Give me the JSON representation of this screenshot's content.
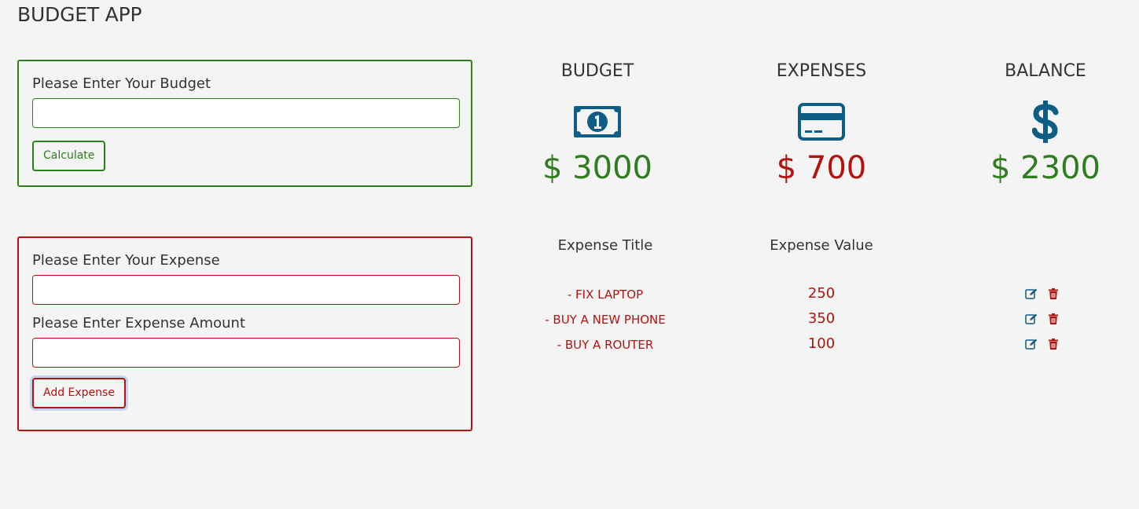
{
  "app": {
    "title": "BUDGET APP"
  },
  "budget_form": {
    "label": "Please Enter Your Budget",
    "input_value": "",
    "button_label": "Calculate"
  },
  "expense_form": {
    "expense_label": "Please Enter Your Expense",
    "expense_value": "",
    "amount_label": "Please Enter Expense Amount",
    "amount_value": "",
    "button_label": "Add Expense"
  },
  "summary": {
    "budget": {
      "title": "BUDGET",
      "amount": "$ 3000",
      "icon": "money-bill-icon"
    },
    "expenses": {
      "title": "EXPENSES",
      "amount": "$ 700",
      "icon": "credit-card-icon"
    },
    "balance": {
      "title": "BALANCE",
      "amount": "$ 2300",
      "icon": "dollar-sign-icon"
    }
  },
  "expense_list": {
    "headers": {
      "title": "Expense Title",
      "value": "Expense Value"
    },
    "items": [
      {
        "title": "- fix laptop",
        "value": "250"
      },
      {
        "title": "- buy a new phone",
        "value": "350"
      },
      {
        "title": "- buy a router",
        "value": "100"
      }
    ]
  },
  "colors": {
    "green": "#2e7d1f",
    "red": "#b1130f",
    "icon_blue": "#0e5d84",
    "background": "#f4f4f4"
  }
}
